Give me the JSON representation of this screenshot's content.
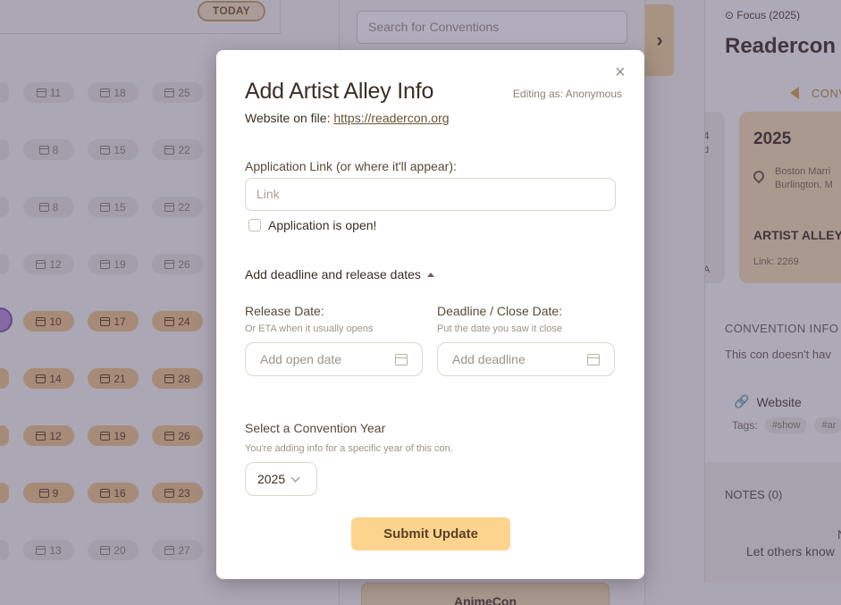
{
  "calendar": {
    "today_label": "TODAY",
    "rows": [
      {
        "days": [
          "11",
          "18",
          "25"
        ],
        "highlighted": false
      },
      {
        "days": [
          "8",
          "15",
          "22"
        ],
        "highlighted": false
      },
      {
        "days": [
          "8",
          "15",
          "22"
        ],
        "highlighted": false
      },
      {
        "days": [
          "12",
          "19",
          "26"
        ],
        "highlighted": false
      },
      {
        "days": [
          "10",
          "17",
          "24"
        ],
        "highlighted": true
      },
      {
        "days": [
          "14",
          "21",
          "28"
        ],
        "highlighted": true
      },
      {
        "days": [
          "12",
          "19",
          "26"
        ],
        "highlighted": true
      },
      {
        "days": [
          "9",
          "16",
          "23"
        ],
        "highlighted": true
      },
      {
        "days": [
          "13",
          "20",
          "27"
        ],
        "highlighted": false
      }
    ]
  },
  "middle": {
    "search_placeholder": "Search for Conventions",
    "bottom_card": "AnimeCon"
  },
  "right": {
    "focus_label": "Focus (2025)",
    "title": "Readercon",
    "conv_nav": "CONV",
    "side_card_line1": "4",
    "side_card_line2": "d",
    "side_card_line3": "A",
    "year": "2025",
    "location_line1": "Boston Marri",
    "location_line2": "Burlington, M",
    "artist_alley": "ARTIST ALLEY",
    "link_count": "Link: 2269",
    "info_heading": "CONVENTION INFO",
    "info_text": "This con doesn't hav",
    "website": "Website",
    "tags_label": "Tags:",
    "tags": [
      "#show",
      "#ar"
    ],
    "notes_heading": "NOTES (0)",
    "notes_line1": "N",
    "notes_line2": "Let others know"
  },
  "modal": {
    "title": "Add Artist Alley Info",
    "editing_as": "Editing as: Anonymous",
    "website_prefix": "Website on file:",
    "website_url": "https://readercon.org",
    "app_link_label": "Application Link (or where it'll appear):",
    "app_link_placeholder": "Link",
    "app_open_label": "Application is open!",
    "dates_toggle": "Add deadline and release dates",
    "release_label": "Release Date:",
    "release_hint": "Or ETA when it usually opens",
    "release_placeholder": "Add open date",
    "deadline_label": "Deadline / Close Date:",
    "deadline_hint": "Put the date you saw it close",
    "deadline_placeholder": "Add deadline",
    "year_label": "Select a Convention Year",
    "year_hint": "You're adding info for a specific year of this con.",
    "year_value": "2025",
    "submit": "Submit Update"
  }
}
